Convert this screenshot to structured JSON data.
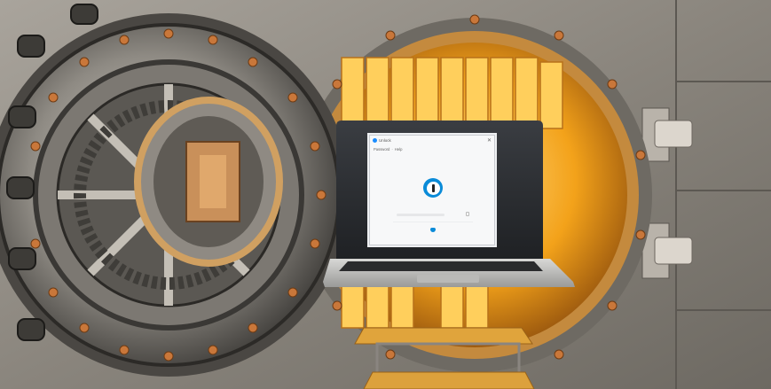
{
  "scene": {
    "subject": "bank-vault-with-laptop",
    "colors": {
      "steel": "#8f8c86",
      "steel_dark": "#3d3b38",
      "steel_light": "#cfcac2",
      "gold": "#f5a21e",
      "gold_light": "#ffd26a",
      "copper": "#c97a3b"
    }
  },
  "app": {
    "title": "Unlock",
    "close_icon": "close-icon",
    "menu": [
      "Password",
      "Help"
    ],
    "menu_separator": "·",
    "logo_icon": "1password-logo-icon",
    "accent": "#0a8bd8"
  }
}
